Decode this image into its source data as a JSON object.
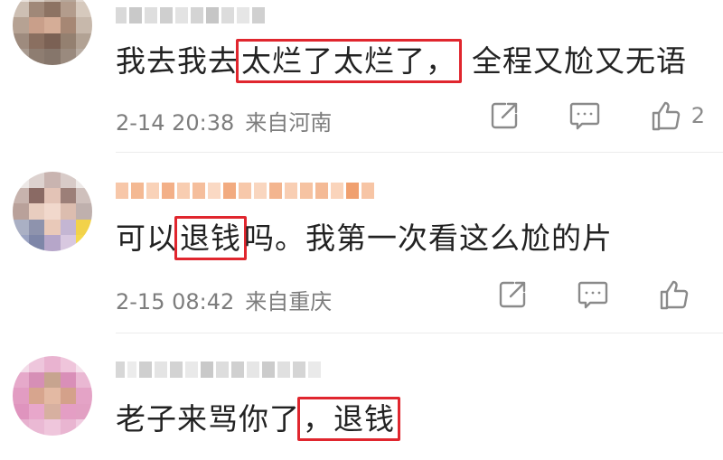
{
  "comments": [
    {
      "text_before": "我去我去",
      "highlight_1": "太烂了太烂了，",
      "text_after": "全程又尬又无语",
      "date": "2-14 20:38",
      "location": "来自河南",
      "likes": "2"
    },
    {
      "text_before": "可以",
      "highlight_1": "退钱",
      "text_after": "吗。我第一次看这么尬的片",
      "date": "2-15 08:42",
      "location": "来自重庆",
      "likes": ""
    },
    {
      "text_before": "老子来骂你了",
      "highlight_1": "，退钱",
      "text_after": ""
    }
  ],
  "icons": {
    "share": "share-icon",
    "comment": "comment-icon",
    "like": "like-icon"
  },
  "colors": {
    "highlight_box": "#e0262e",
    "meta_text": "#7d7d7d",
    "icon": "#8a8a8a"
  }
}
